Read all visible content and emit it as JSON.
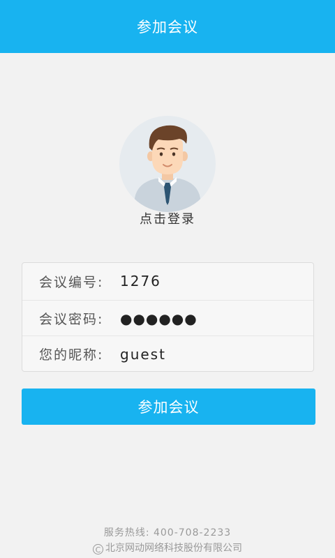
{
  "header": {
    "title": "参加会议"
  },
  "avatar": {
    "icon": "user-avatar-icon",
    "login_label": "点击登录"
  },
  "form": {
    "meeting_id": {
      "label": "会议编号:",
      "value": "1276"
    },
    "meeting_password": {
      "label": "会议密码:",
      "value": "●●●●●●"
    },
    "nickname": {
      "label": "您的昵称:",
      "value": "guest"
    }
  },
  "join_button": {
    "label": "参加会议"
  },
  "footer": {
    "hotline": "服务热线:  400-708-2233",
    "copyright_symbol": "C",
    "company": "北京网动网络科技股份有限公司"
  },
  "colors": {
    "accent": "#18b3f0",
    "background": "#f2f2f2"
  }
}
